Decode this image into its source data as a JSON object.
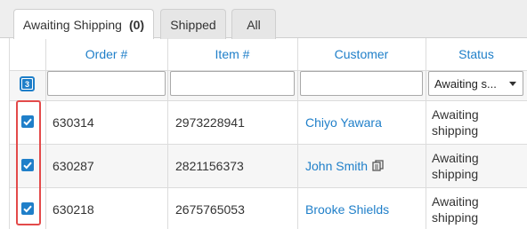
{
  "tabs": [
    {
      "label": "Awaiting Shipping",
      "count": "(0)"
    },
    {
      "label": "Shipped",
      "count": ""
    },
    {
      "label": "All",
      "count": ""
    }
  ],
  "columns": {
    "order": "Order #",
    "item": "Item #",
    "customer": "Customer",
    "status": "Status"
  },
  "filters": {
    "selected_count": "3",
    "status_value": "Awaiting s..."
  },
  "rows": [
    {
      "order": "630314",
      "item": "2973228941",
      "customer": "Chiyo Yawara",
      "status_line1": "Awaiting",
      "status_line2": "shipping",
      "checked": true,
      "has_note": false
    },
    {
      "order": "630287",
      "item": "2821156373",
      "customer": "John Smith",
      "status_line1": "Awaiting",
      "status_line2": "shipping",
      "checked": true,
      "has_note": true
    },
    {
      "order": "630218",
      "item": "2675765053",
      "customer": "Brooke Shields",
      "status_line1": "Awaiting",
      "status_line2": "shipping",
      "checked": true,
      "has_note": false
    }
  ],
  "icons": {
    "checkbox": "checkmark-icon",
    "note": "copy-icon",
    "dropdown": "chevron-down-icon"
  },
  "colors": {
    "accent": "#1f7fc9",
    "highlight": "#e34a4a"
  }
}
